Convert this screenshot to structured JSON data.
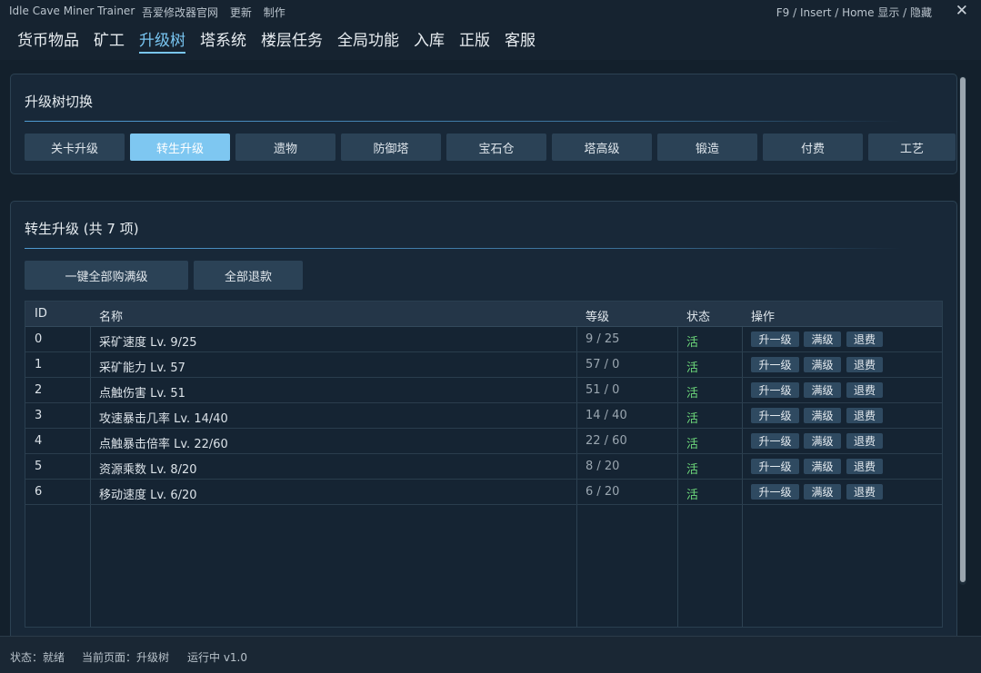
{
  "titlebar": {
    "app_title": "Idle Cave Miner Trainer",
    "links": [
      "吾爱修改器官网",
      "更新",
      "制作"
    ],
    "hotkey_hint": "F9 / Insert / Home  显示 / 隐藏",
    "close_glyph": "✕"
  },
  "nav": {
    "tabs": [
      "货币物品",
      "矿工",
      "升级树",
      "塔系统",
      "楼层任务",
      "全局功能",
      "入库",
      "正版",
      "客服"
    ],
    "active_index": 2
  },
  "tree_switch": {
    "title": "升级树切换",
    "tabs": [
      "关卡升级",
      "转生升级",
      "遗物",
      "防御塔",
      "宝石仓",
      "塔高级",
      "锻造",
      "付费",
      "工艺"
    ],
    "active_index": 1
  },
  "list_panel": {
    "title": "转生升级 (共 7 项)",
    "buttons": {
      "buy_all_max": "一键全部购满级",
      "refund_all": "全部退款"
    },
    "columns": {
      "id": "ID",
      "name": "名称",
      "level": "等级",
      "status": "状态",
      "ops": "操作"
    },
    "op_labels": {
      "upgrade": "升一级",
      "max": "满级",
      "refund": "退费"
    },
    "rows": [
      {
        "id": "0",
        "name": "采矿速度 Lv. 9/25",
        "level": "9 / 25",
        "status": "活"
      },
      {
        "id": "1",
        "name": "采矿能力 Lv. 57",
        "level": "57 / 0",
        "status": "活"
      },
      {
        "id": "2",
        "name": "点触伤害 Lv. 51",
        "level": "51 / 0",
        "status": "活"
      },
      {
        "id": "3",
        "name": "攻速暴击几率 Lv. 14/40",
        "level": "14 / 40",
        "status": "活"
      },
      {
        "id": "4",
        "name": "点触暴击倍率 Lv. 22/60",
        "level": "22 / 60",
        "status": "活"
      },
      {
        "id": "5",
        "name": "资源乘数 Lv. 8/20",
        "level": "8 / 20",
        "status": "活"
      },
      {
        "id": "6",
        "name": "移动速度 Lv. 6/20",
        "level": "6 / 20",
        "status": "活"
      }
    ]
  },
  "statusbar": {
    "status": "状态：就绪",
    "current_page": "当前页面：升级树",
    "running": "运行中  v1.0"
  },
  "colors": {
    "accent": "#79c6f2",
    "active_status": "#6fdc7c",
    "background": "#162330"
  }
}
